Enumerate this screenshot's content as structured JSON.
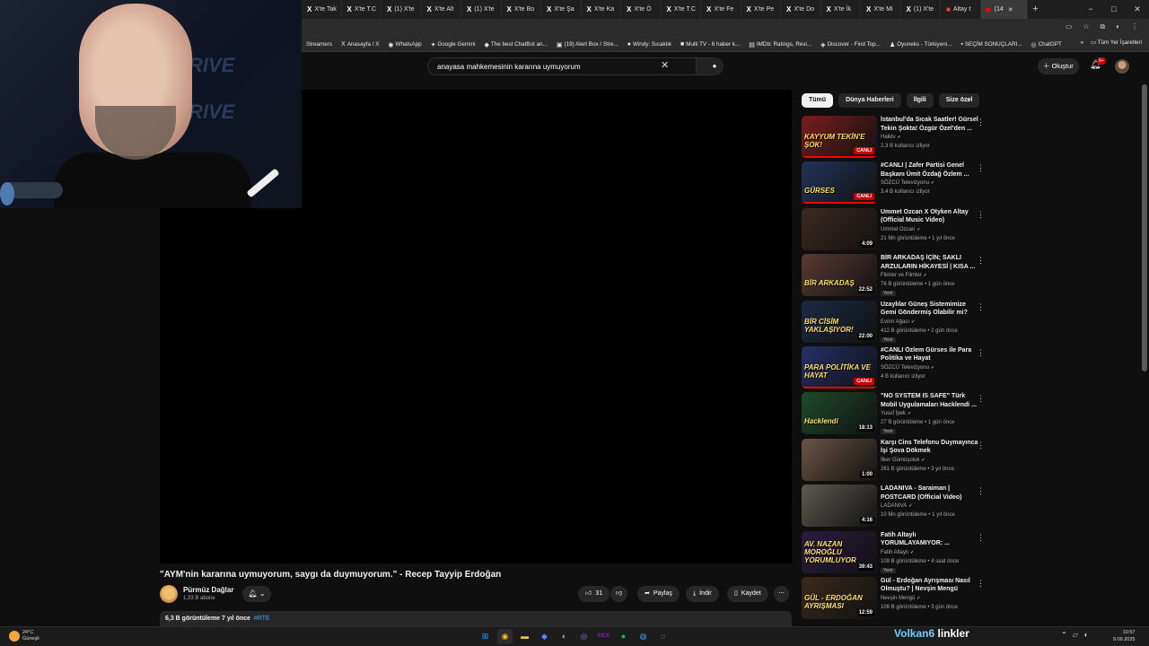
{
  "browser": {
    "tabs": [
      {
        "icon": "X",
        "label": "X'te Tak"
      },
      {
        "icon": "X",
        "label": "X'te T.C"
      },
      {
        "icon": "X",
        "label": "(1) X'te"
      },
      {
        "icon": "X",
        "label": "X'te Alt"
      },
      {
        "icon": "X",
        "label": "(1) X'te"
      },
      {
        "icon": "X",
        "label": "X'te Bo"
      },
      {
        "icon": "X",
        "label": "X'te Şa"
      },
      {
        "icon": "X",
        "label": "X'te Ka"
      },
      {
        "icon": "X",
        "label": "X'te Ö"
      },
      {
        "icon": "X",
        "label": "X'te T.C"
      },
      {
        "icon": "X",
        "label": "X'te Fe"
      },
      {
        "icon": "X",
        "label": "X'te Pe"
      },
      {
        "icon": "X",
        "label": "X'te Do"
      },
      {
        "icon": "X",
        "label": "X'te İk"
      },
      {
        "icon": "X",
        "label": "X'te Mi"
      },
      {
        "icon": "X",
        "label": "(1) X'te"
      },
      {
        "icon": "■",
        "label": "Altay t"
      },
      {
        "icon": "▶",
        "label": "(14"
      }
    ],
    "new_tab": "+",
    "window_controls": [
      "−",
      "□",
      "✕"
    ],
    "bookmarks": [
      {
        "icon": "",
        "label": "Streamers"
      },
      {
        "icon": "X",
        "label": "Anasayfa / X"
      },
      {
        "icon": "◉",
        "label": "WhatsApp"
      },
      {
        "icon": "✦",
        "label": "Google Gemini"
      },
      {
        "icon": "◆",
        "label": "The best ChatBot an..."
      },
      {
        "icon": "▣",
        "label": "(19) Alert Box / Stre..."
      },
      {
        "icon": "●",
        "label": "Windy: Sıcaklık"
      },
      {
        "icon": "■",
        "label": "Multi TV - 6 haber k..."
      },
      {
        "icon": "▤",
        "label": "IMDb: Ratings, Revi..."
      },
      {
        "icon": "◈",
        "label": "Discover - Find Top..."
      },
      {
        "icon": "♟",
        "label": "Oyuneks - Türkiyeni..."
      },
      {
        "icon": "▪",
        "label": "SEÇİM SONUÇLARI..."
      },
      {
        "icon": "◎",
        "label": "ChatGPT"
      }
    ],
    "bookmarks_more": "»",
    "all_bookmarks": "Tüm Yer İşaretleri"
  },
  "youtube": {
    "search_value": "anayasa mahkemesinin kararına uymuyorum",
    "create_label": "Oluştur",
    "notification_count": "9+"
  },
  "video": {
    "title": "\"AYM'nin kararına uymuyorum, saygı da duymuyorum.\" - Recep Tayyip Erdoğan",
    "channel": "Pürmüz Dağlar",
    "subscribers": "1,33 B abone",
    "likes": "31",
    "share": "Paylaş",
    "download": "İndir",
    "save": "Kaydet",
    "views_date": "6,3 B görüntüleme  7 yıl önce",
    "hashtag": "#RTE"
  },
  "chips": [
    "Tümü",
    "Dünya Haberleri",
    "İlgili",
    "Size özel"
  ],
  "recommendations": [
    {
      "title": "İstanbul'da Sıcak Saatler! Gürsel Tekin Şokta! Özgür Özel'den ...",
      "channel": "Halktv",
      "meta": "2,3 B kullanıcı izliyor",
      "caption": "KAYYUM TEKİN'E ŞOK!",
      "badge": "CANLI",
      "duration": "",
      "new": "",
      "bg": "#7a1d1d"
    },
    {
      "title": "#CANLI | Zafer Partisi Genel Başkanı Ümit Özdağ Özlem ...",
      "channel": "SÖZCÜ Televizyonu",
      "meta": "3,4 B kullanıcı izliyor",
      "caption": "GÜRSES",
      "badge": "CANLI",
      "duration": "",
      "new": "",
      "bg": "#22335a"
    },
    {
      "title": "Ummet Ozcan X Otyken   Altay (Official Music Video)",
      "channel": "Ummet Ozcan",
      "meta": "21 Mn görüntüleme • 1 yıl önce",
      "caption": "",
      "badge": "",
      "duration": "4:09",
      "new": "",
      "bg": "#3d2a22"
    },
    {
      "title": "BİR ARKADAŞ İÇİN; SAKLI ARZULARIN HİKAYESİ | KISA ...",
      "channel": "Filmler ve Filmler",
      "meta": "76 B görüntüleme • 1 gün önce",
      "caption": "BİR ARKADAŞ",
      "badge": "",
      "duration": "22:52",
      "new": "Yeni",
      "bg": "#5a3b35"
    },
    {
      "title": "Uzaylılar Güneş Sistemimize Gemi Göndermiş Olabilir mi?",
      "channel": "Evrim Ağacı",
      "meta": "412 B görüntüleme • 2 gün önce",
      "caption": "BİR CİSİM YAKLAŞIYOR!",
      "badge": "",
      "duration": "22:00",
      "new": "Yeni",
      "bg": "#1b2a44"
    },
    {
      "title": "#CANLI Özlem Gürses ile Para Politika ve Hayat",
      "channel": "SÖZCÜ Televizyonu",
      "meta": "4 B kullanıcı izliyor",
      "caption": "PARA POLİTİKA VE HAYAT",
      "badge": "CANLI",
      "duration": "",
      "new": "",
      "bg": "#25306a"
    },
    {
      "title": "\"NO SYSTEM IS SAFE\" Türk Mobil Uygulamaları Hacklendi ...",
      "channel": "Yusuf İpek",
      "meta": "27 B görüntüleme • 1 gün önce",
      "caption": "Hacklendi",
      "badge": "",
      "duration": "18:13",
      "new": "Yeni",
      "bg": "#1e4a2a"
    },
    {
      "title": "Karşı Cins Telefonu Duymayınca İşi Şova Dökmek",
      "channel": "İlker Gümüşoluk",
      "meta": "261 B görüntüleme • 3 yıl önce",
      "caption": "",
      "badge": "",
      "duration": "1:00",
      "new": "",
      "bg": "#6a5546"
    },
    {
      "title": "LADANIVA - Saraiman | POSTCARD (Official Video)",
      "channel": "LADANIVA",
      "meta": "10 Mn görüntüleme • 1 yıl önce",
      "caption": "",
      "badge": "",
      "duration": "4:16",
      "new": "",
      "bg": "#5e5a52"
    },
    {
      "title": "Fatih Altaylı YORUMLAYAMIYOR: ...",
      "channel": "Fatih Altaylı",
      "meta": "109 B görüntüleme • 4 saat önce",
      "caption": "AV. NAZAN MOROĞLU YORUMLUYOR",
      "badge": "",
      "duration": "39:43",
      "new": "Yeni",
      "bg": "#2a1c3d"
    },
    {
      "title": "Gül - Erdoğan Ayrışması Nasıl Olmuştu? | Nevşin Mengü",
      "channel": "Nevşin Mengü",
      "meta": "108 B görüntüleme • 3 gün önce",
      "caption": "GÜL - ERDOĞAN AYRIŞMASI",
      "badge": "",
      "duration": "12:59",
      "new": "",
      "bg": "#3a2a1c"
    }
  ],
  "taskbar": {
    "temp": "24°C",
    "weather": "Güneşli",
    "time": "10:57",
    "date": "9.09.2025"
  },
  "overlay": {
    "word_a": "Volkan6",
    "word_b": "linkler"
  },
  "colors": {
    "accent_red": "#ff0000",
    "link_blue": "#3ea6ff",
    "bg": "#0f0f0f"
  }
}
